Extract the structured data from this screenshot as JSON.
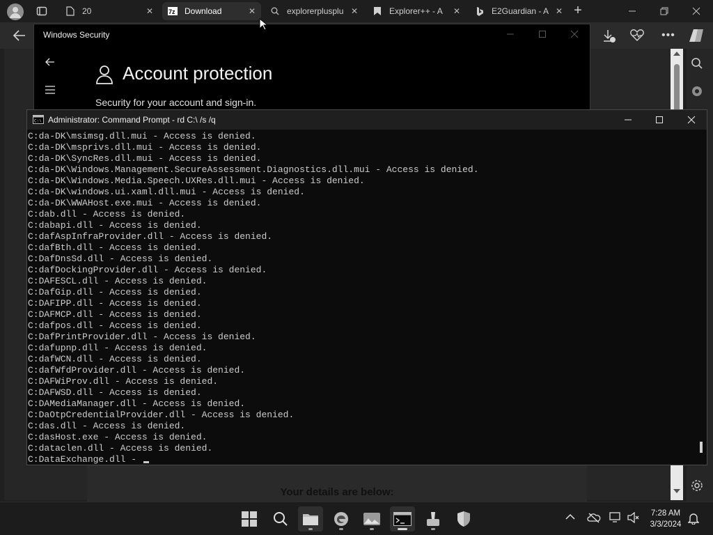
{
  "browser": {
    "tabs": [
      {
        "title": "20",
        "icon": "document-icon",
        "active": false
      },
      {
        "title": "Download",
        "icon": "7zip-icon",
        "active": true
      },
      {
        "title": "explorerplusplu",
        "icon": "search-icon",
        "active": false
      },
      {
        "title": "Explorer++ - A",
        "icon": "bookmark-icon",
        "active": false
      },
      {
        "title": "E2Guardian - A",
        "icon": "bing-icon",
        "active": false
      }
    ],
    "new_tab_symbol": "+"
  },
  "windows_security": {
    "title": "Windows Security",
    "heading": "Account protection",
    "subheading": "Security for your account and sign-in."
  },
  "page": {
    "details_text": "Your details are below:"
  },
  "cmd": {
    "title": "Administrator: Command Prompt - rd  C:\\ /s /q",
    "lines": [
      "C:da-DK\\msimsg.dll.mui - Access is denied.",
      "C:da-DK\\msprivs.dll.mui - Access is denied.",
      "C:da-DK\\SyncRes.dll.mui - Access is denied.",
      "C:da-DK\\Windows.Management.SecureAssessment.Diagnostics.dll.mui - Access is denied.",
      "C:da-DK\\Windows.Media.Speech.UXRes.dll.mui - Access is denied.",
      "C:da-DK\\windows.ui.xaml.dll.mui - Access is denied.",
      "C:da-DK\\WWAHost.exe.mui - Access is denied.",
      "C:dab.dll - Access is denied.",
      "C:dabapi.dll - Access is denied.",
      "C:dafAspInfraProvider.dll - Access is denied.",
      "C:dafBth.dll - Access is denied.",
      "C:DafDnsSd.dll - Access is denied.",
      "C:dafDockingProvider.dll - Access is denied.",
      "C:DAFESCL.dll - Access is denied.",
      "C:DafGip.dll - Access is denied.",
      "C:DAFIPP.dll - Access is denied.",
      "C:DAFMCP.dll - Access is denied.",
      "C:dafpos.dll - Access is denied.",
      "C:DafPrintProvider.dll - Access is denied.",
      "C:dafupnp.dll - Access is denied.",
      "C:dafWCN.dll - Access is denied.",
      "C:dafWfdProvider.dll - Access is denied.",
      "C:DAFWiProv.dll - Access is denied.",
      "C:DAFWSD.dll - Access is denied.",
      "C:DAMediaManager.dll - Access is denied.",
      "C:DaOtpCredentialProvider.dll - Access is denied.",
      "C:das.dll - Access is denied.",
      "C:dasHost.exe - Access is denied.",
      "C:dataclen.dll - Access is denied.",
      "C:DataExchange.dll - "
    ]
  },
  "taskbar": {
    "apps": [
      "start-icon",
      "search-icon",
      "file-explorer-icon",
      "edge-icon",
      "photos-icon",
      "command-prompt-icon",
      "paint-icon",
      "windows-security-icon"
    ],
    "time": "7:28 AM",
    "date": "3/3/2024"
  }
}
